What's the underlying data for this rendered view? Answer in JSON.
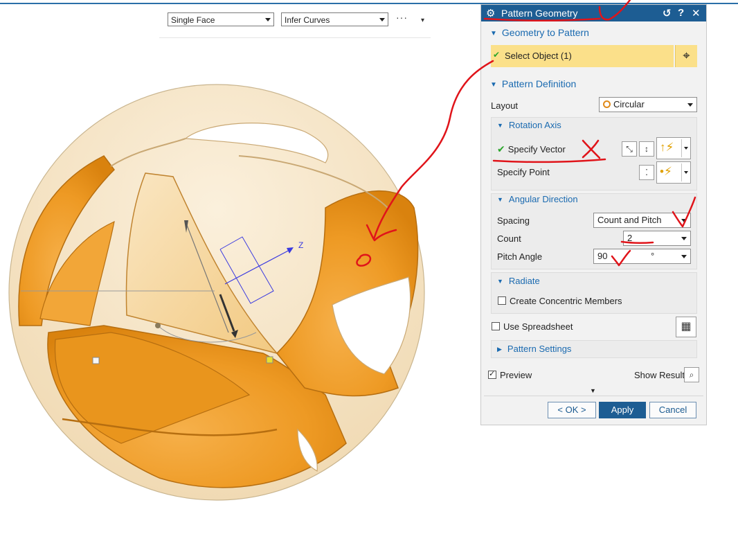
{
  "toolbar": {
    "filter_value": "Single Face",
    "curve_rule_value": "Infer Curves",
    "more_label": "···"
  },
  "viewport": {
    "axis_label": "Z"
  },
  "dialog": {
    "title": "Pattern Geometry",
    "geometry_section": "Geometry to Pattern",
    "select_object": "Select Object (1)",
    "definition_section": "Pattern Definition",
    "layout_label": "Layout",
    "layout_value": "Circular",
    "rotation_axis_section": "Rotation Axis",
    "specify_vector": "Specify Vector",
    "specify_point": "Specify Point",
    "angular_section": "Angular Direction",
    "spacing_label": "Spacing",
    "spacing_value": "Count and Pitch",
    "count_label": "Count",
    "count_value": "2",
    "pitch_label": "Pitch Angle",
    "pitch_value": "90",
    "pitch_unit": "°",
    "radiate_section": "Radiate",
    "concentric_label": "Create Concentric Members",
    "spreadsheet_label": "Use Spreadsheet",
    "settings_section": "Pattern Settings",
    "preview_label": "Preview",
    "show_result_label": "Show Result",
    "ok_label": "< OK >",
    "apply_label": "Apply",
    "cancel_label": "Cancel"
  },
  "colors": {
    "title_bar": "#1d5d93",
    "section_text": "#1a6ab0",
    "selection_highlight": "#fbe08a",
    "body_orange": "#f2a22f",
    "body_cream": "#f6e3c3",
    "annotation_red": "#e0141a"
  }
}
